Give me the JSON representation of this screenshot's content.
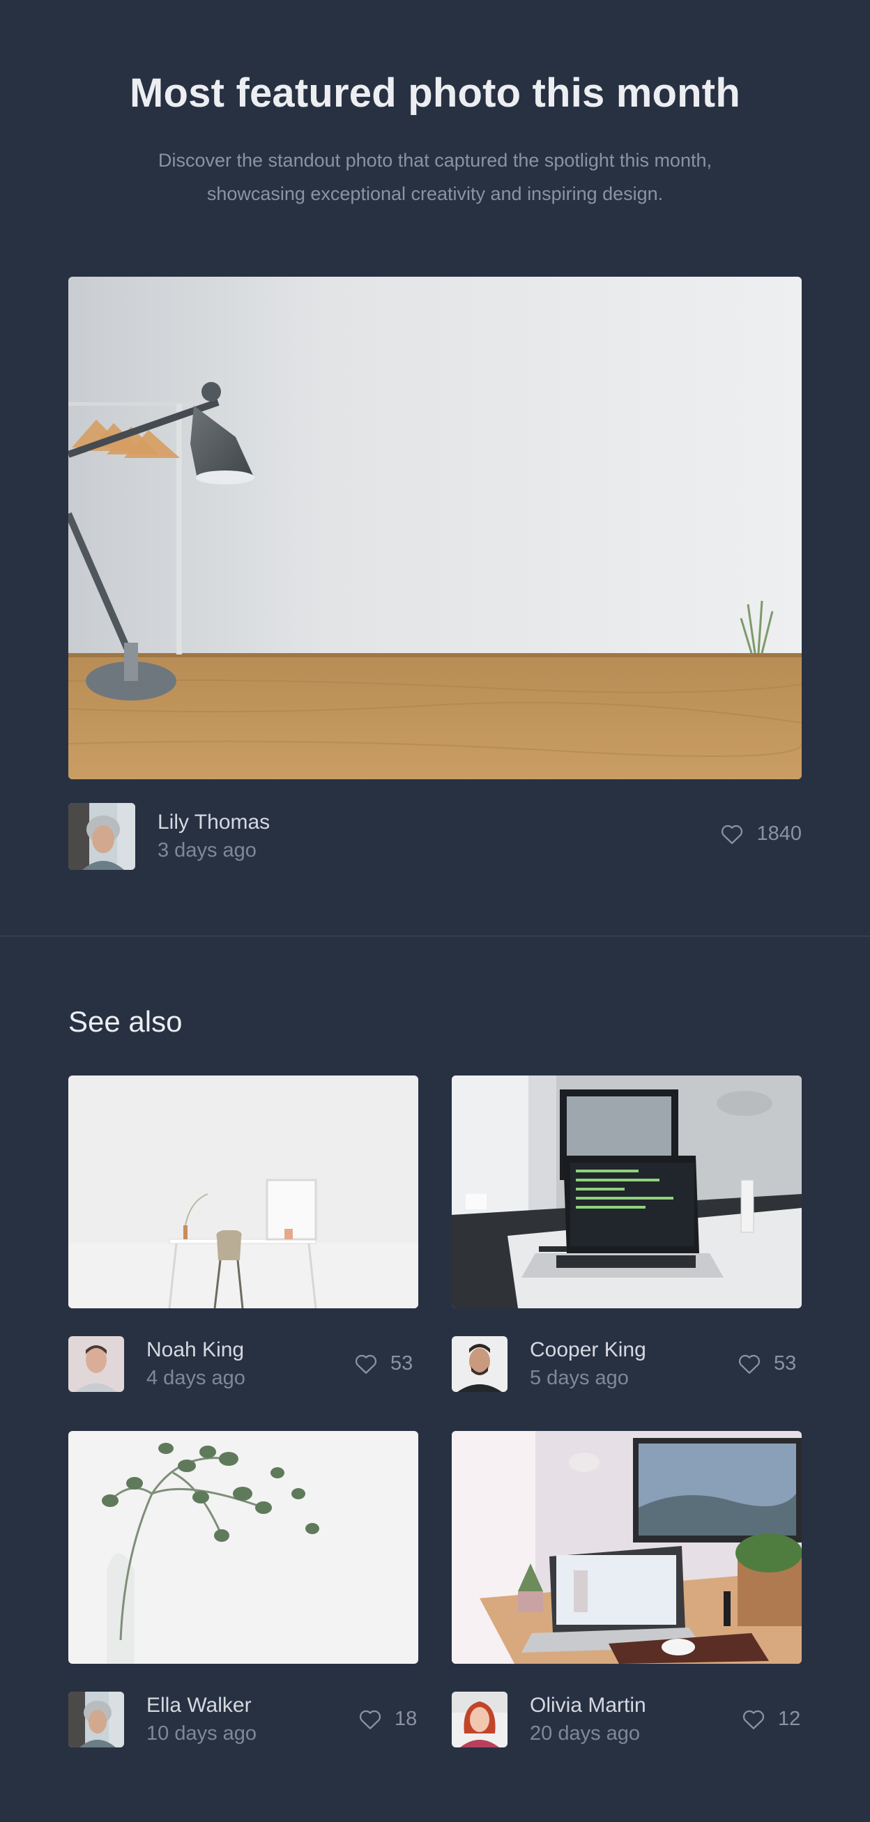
{
  "hero": {
    "title": "Most featured photo this month",
    "subtitle_line1": "Discover the standout photo that captured the spotlight this month,",
    "subtitle_line2": "showcasing exceptional creativity and inspiring design."
  },
  "featured": {
    "author": "Lily Thomas",
    "time": "3 days ago",
    "likes": "1840"
  },
  "see_also": {
    "heading": "See also",
    "cards": [
      {
        "author": "Noah King",
        "time": "4 days ago",
        "likes": "53"
      },
      {
        "author": "Cooper King",
        "time": "5 days ago",
        "likes": "53"
      },
      {
        "author": "Ella Walker",
        "time": "10 days ago",
        "likes": "18"
      },
      {
        "author": "Olivia Martin",
        "time": "20 days ago",
        "likes": "12"
      }
    ]
  },
  "colors": {
    "background": "#283142",
    "text_primary": "#eceef2",
    "text_muted": "#8b93a2"
  },
  "icons": {
    "like": "heart-icon"
  }
}
